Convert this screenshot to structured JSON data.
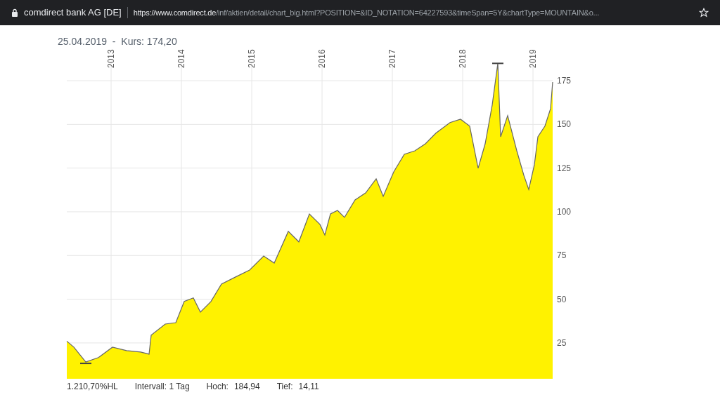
{
  "browser": {
    "title": "comdirect bank AG [DE]",
    "url_host": "https://www.comdirect.de",
    "url_path": "/inf/aktien/detail/chart_big.html?POSITION=&ID_NOTATION=64227593&timeSpan=5Y&chartType=MOUNTAIN&o..."
  },
  "chart_header": "25.04.2019  -  Kurs: 174,20",
  "chart": {
    "chart_data": {
      "type": "area",
      "xlim": [
        2012.37,
        2019.28
      ],
      "grid": true,
      "ylim": [
        4.5,
        186
      ],
      "xticks": [
        2013,
        2014,
        2015,
        2016,
        2017,
        2018,
        2019
      ],
      "yticks": [
        25,
        50,
        75,
        100,
        125,
        150,
        175
      ],
      "x": [
        2012.37,
        2012.47,
        2012.64,
        2012.82,
        2013.02,
        2013.22,
        2013.42,
        2013.54,
        2013.57,
        2013.77,
        2013.92,
        2014.04,
        2014.17,
        2014.27,
        2014.42,
        2014.57,
        2014.77,
        2014.97,
        2015.17,
        2015.32,
        2015.52,
        2015.67,
        2015.82,
        2015.97,
        2016.04,
        2016.12,
        2016.22,
        2016.32,
        2016.47,
        2016.62,
        2016.77,
        2016.87,
        2017.02,
        2017.17,
        2017.32,
        2017.47,
        2017.62,
        2017.82,
        2017.97,
        2018.1,
        2018.22,
        2018.32,
        2018.42,
        2018.5,
        2018.54,
        2018.64,
        2018.77,
        2018.87,
        2018.94,
        2019.02,
        2019.07,
        2019.17,
        2019.25,
        2019.28
      ],
      "series": [
        {
          "color": "#fff200",
          "values": [
            26,
            22.6,
            14.1,
            16.6,
            22.6,
            20.6,
            19.8,
            18.6,
            29.4,
            35.8,
            36.6,
            48.7,
            50.7,
            42.6,
            48.7,
            58.7,
            62.7,
            66.7,
            74.7,
            70.7,
            88.8,
            82.8,
            98.8,
            92.8,
            86.8,
            98.8,
            100.8,
            96.8,
            106.8,
            110.8,
            118.9,
            108.8,
            122.9,
            132.9,
            134.9,
            138.9,
            145,
            151,
            153,
            149,
            124.9,
            138.9,
            161,
            184.9,
            142.9,
            155,
            134.9,
            120.9,
            112.8,
            126.9,
            142.9,
            149,
            159,
            174.2
          ]
        }
      ]
    },
    "high_marker": true,
    "low_marker": true
  },
  "footer": [
    {
      "label": "1.210,70%HL"
    },
    {
      "label": "Intervall: 1 Tag"
    },
    {
      "label": "Hoch:",
      "value": "184,94"
    },
    {
      "label": "Tief:",
      "value": "14,11"
    }
  ]
}
